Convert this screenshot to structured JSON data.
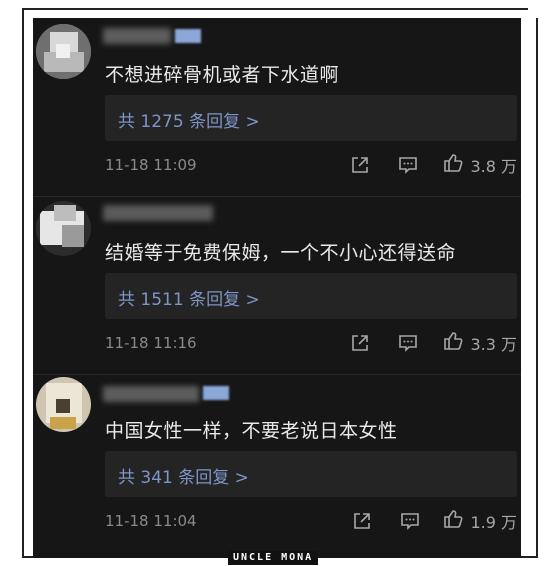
{
  "comments": [
    {
      "text": "不想进碎骨机或者下水道啊",
      "replies": "共 1275 条回复 >",
      "time": "11-18 11:09",
      "likes": "3.8 万"
    },
    {
      "text": "结婚等于免费保姆，一个不小心还得送命",
      "replies": "共 1511 条回复 >",
      "time": "11-18 11:16",
      "likes": "3.3 万"
    },
    {
      "text": "中国女性一样，不要老说日本女性",
      "replies": "共 341 条回复 >",
      "time": "11-18 11:04",
      "likes": "1.9 万"
    }
  ],
  "watermark": "UNCLE MONA",
  "icons": {
    "share": "share-icon",
    "comment": "comment-icon",
    "like": "thumbs-up-icon"
  },
  "colors": {
    "background": "#161616",
    "text": "#e9e9e9",
    "reply_link": "#7f95c7",
    "meta": "#8a8a8a"
  }
}
